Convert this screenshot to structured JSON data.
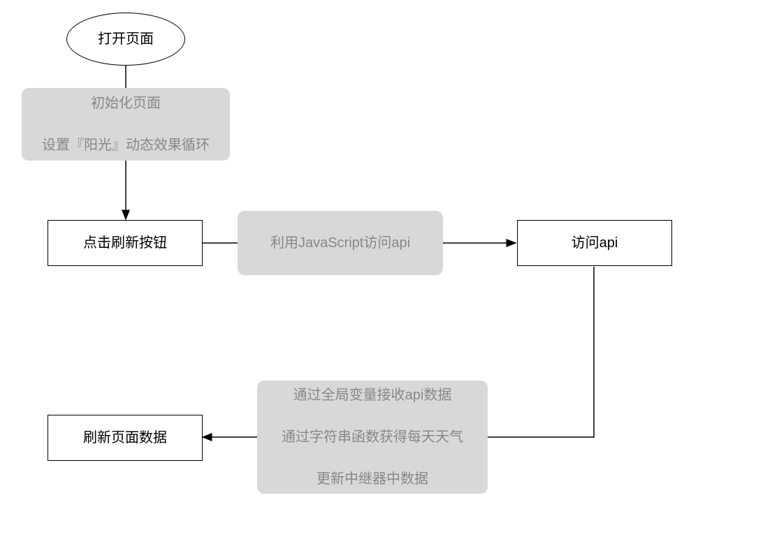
{
  "nodes": {
    "start": {
      "label": "打开页面"
    },
    "init": {
      "line1": "初始化页面",
      "line2": "设置『阳光』动态效果循环"
    },
    "clickRefresh": {
      "label": "点击刷新按钮"
    },
    "useJs": {
      "label": "利用JavaScript访问api"
    },
    "accessApi": {
      "label": "访问api"
    },
    "process": {
      "line1": "通过全局变量接收api数据",
      "line2": "通过字符串函数获得每天天气",
      "line3": "更新中继器中数据"
    },
    "refreshData": {
      "label": "刷新页面数据"
    }
  },
  "edges": [
    {
      "from": "start",
      "to": "clickRefresh",
      "via": "init"
    },
    {
      "from": "clickRefresh",
      "to": "accessApi",
      "via": "useJs"
    },
    {
      "from": "accessApi",
      "to": "refreshData",
      "via": "process"
    }
  ]
}
